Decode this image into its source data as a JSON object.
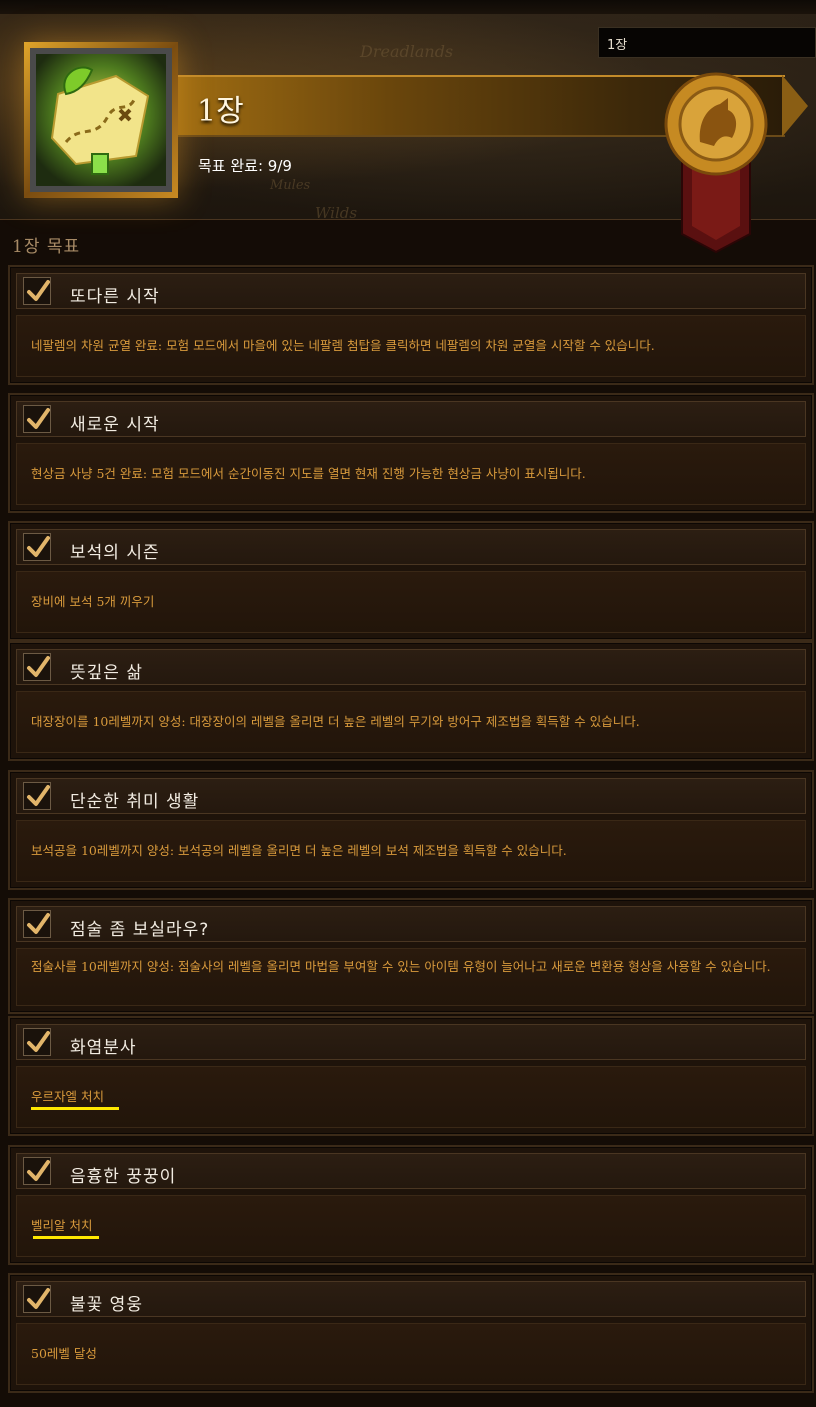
{
  "search": {
    "value": "1장"
  },
  "header": {
    "chapter_title": "1장",
    "progress_label": "목표 완료: 9/9",
    "map_labels": [
      "Dreadlands",
      "Mules",
      "Wilds"
    ]
  },
  "section": {
    "title": "1장 목표"
  },
  "objectives": [
    {
      "title": "또다른 시작",
      "desc": "네팔렘의 차원 균열 완료: 모험 모드에서 마을에 있는 네팔렘 첨탑을 클릭하면 네팔렘의 차원 균열을 시작할 수 있습니다.",
      "completed": true
    },
    {
      "title": "새로운 시작",
      "desc": "현상금 사냥 5건 완료: 모험 모드에서 순간이동진 지도를 열면 현재 진행 가능한 현상금 사냥이 표시됩니다.",
      "completed": true
    },
    {
      "title": "보석의 시즌",
      "desc": "장비에 보석 5개 끼우기",
      "completed": true
    },
    {
      "title": "뜻깊은 삶",
      "desc": "대장장이를 10레벨까지 양성: 대장장이의 레벨을 올리면 더 높은 레벨의 무기와 방어구 제조법을 획득할 수 있습니다.",
      "completed": true
    },
    {
      "title": "단순한 취미 생활",
      "desc": "보석공을 10레벨까지 양성: 보석공의 레벨을 올리면 더 높은 레벨의 보석 제조법을 획득할 수 있습니다.",
      "completed": true
    },
    {
      "title": "점술 좀 보실라우?",
      "desc": "점술사를 10레벨까지 양성: 점술사의 레벨을 올리면 마법을 부여할 수 있는 아이템 유형이 늘어나고 새로운 변환용 형상을 사용할 수 있습니다.",
      "completed": true
    },
    {
      "title": "화염분사",
      "desc": "우르자엘 처치",
      "completed": true
    },
    {
      "title": "음흉한 꿍꿍이",
      "desc": "벨리알 처치",
      "completed": true
    },
    {
      "title": "불꽃 영웅",
      "desc": "50레벨 달성",
      "completed": true
    }
  ],
  "colors": {
    "accent_gold": "#d89a3c",
    "highlight_underline": "#ffe800",
    "check_gold": "#e2b56a"
  }
}
